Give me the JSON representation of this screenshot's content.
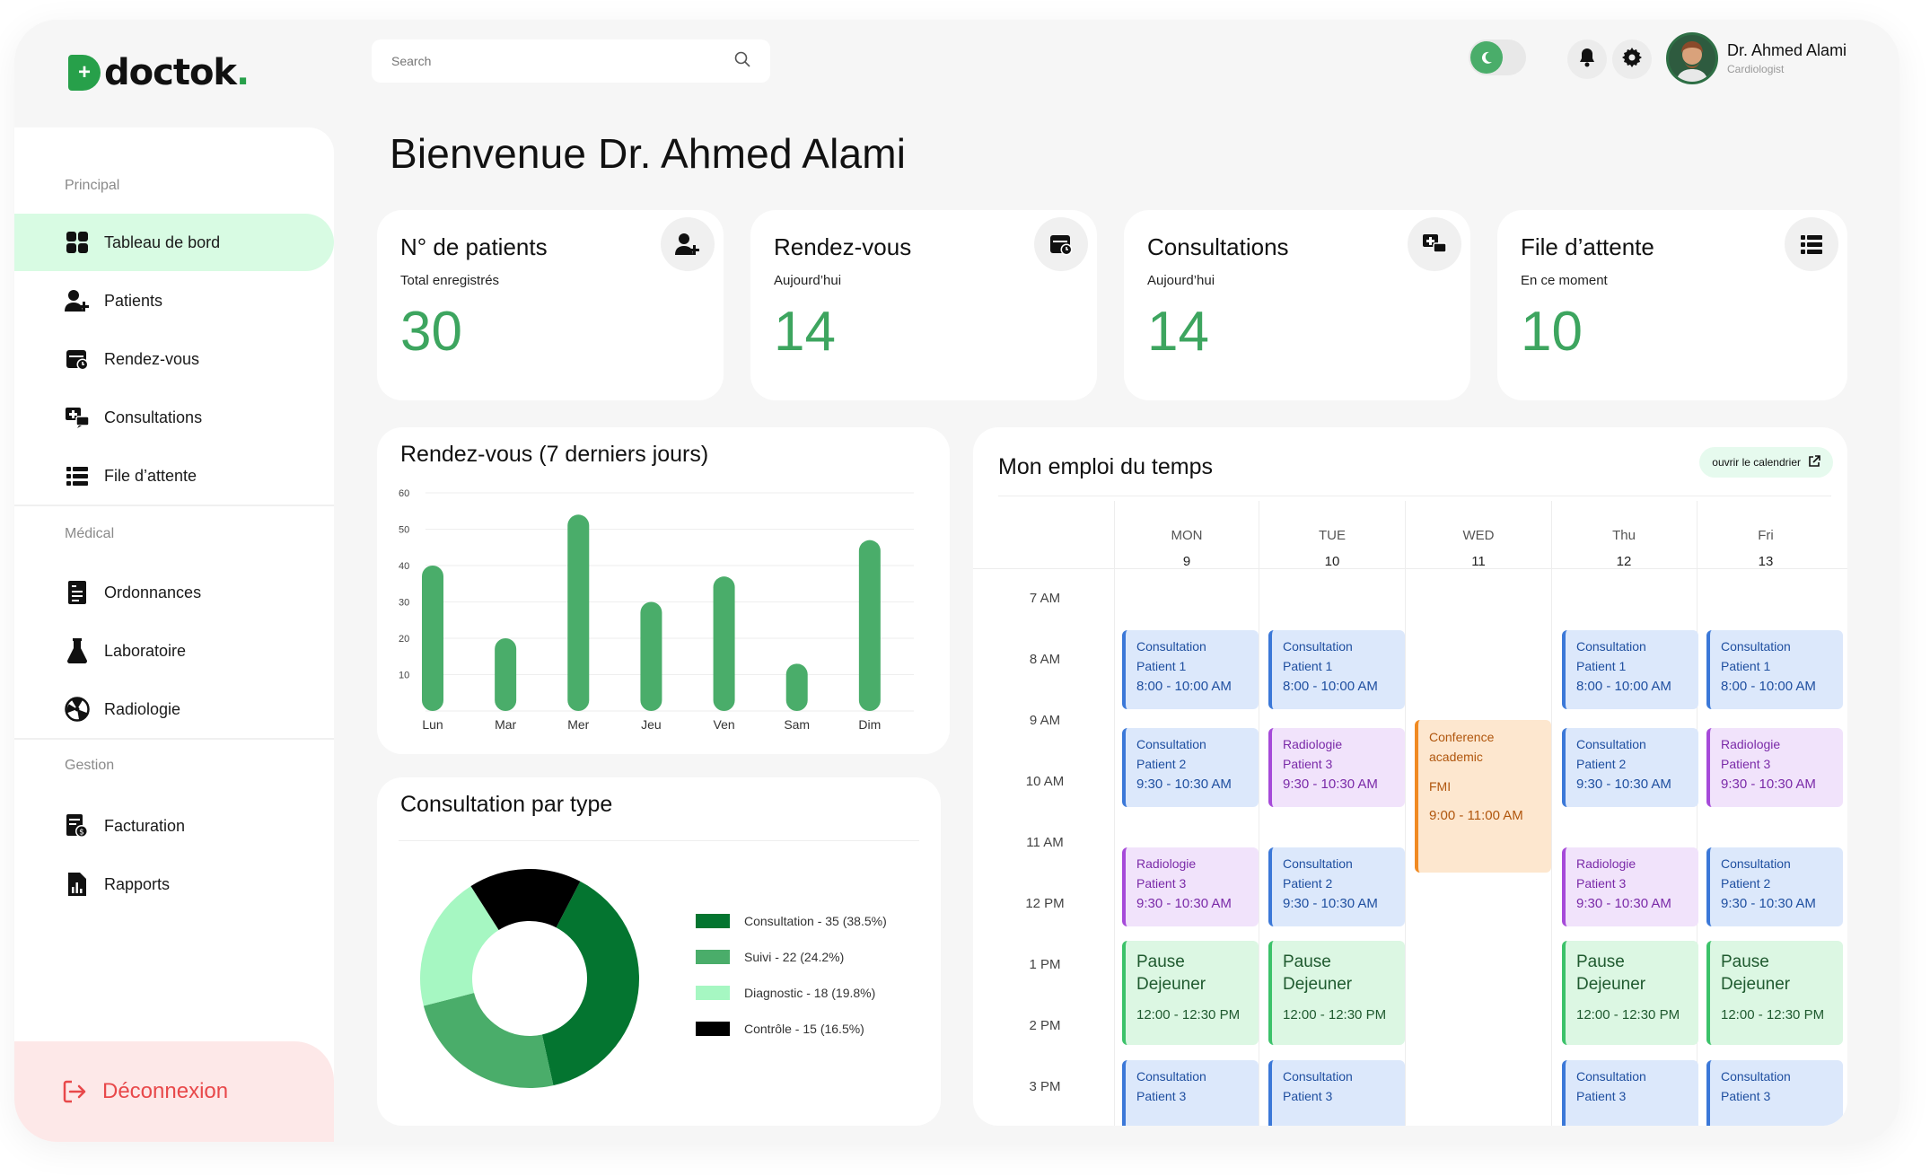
{
  "brand": {
    "name": "doctok",
    "dot": ".",
    "mark": "+"
  },
  "search": {
    "placeholder": "Search"
  },
  "user": {
    "name": "Dr. Ahmed Alami",
    "role": "Cardiologist"
  },
  "welcome": "Bienvenue Dr. Ahmed Alami",
  "sidebar": {
    "sections": [
      "Principal",
      "Médical",
      "Gestion"
    ],
    "items": [
      {
        "label": "Tableau de bord",
        "icon": "dashboard-icon"
      },
      {
        "label": "Patients",
        "icon": "user-plus-icon"
      },
      {
        "label": "Rendez-vous",
        "icon": "calendar-clock-icon"
      },
      {
        "label": "Consultations",
        "icon": "consultation-icon"
      },
      {
        "label": "File d’attente",
        "icon": "list-icon"
      },
      {
        "label": "Ordonnances",
        "icon": "prescription-icon"
      },
      {
        "label": "Laboratoire",
        "icon": "flask-icon"
      },
      {
        "label": "Radiologie",
        "icon": "radiation-icon"
      },
      {
        "label": "Facturation",
        "icon": "invoice-icon"
      },
      {
        "label": "Rapports",
        "icon": "report-icon"
      }
    ],
    "logout": "Déconnexion"
  },
  "stats": [
    {
      "title": "N° de patients",
      "sub": "Total enregistrés",
      "value": "30"
    },
    {
      "title": "Rendez-vous",
      "sub": "Aujourd’hui",
      "value": "14"
    },
    {
      "title": "Consultations",
      "sub": "Aujourd’hui",
      "value": "14"
    },
    {
      "title": "File d’attente",
      "sub": "En ce moment",
      "value": "10"
    }
  ],
  "appointments_chart_title": "Rendez-vous (7 derniers jours)",
  "consult_chart_title": "Consultation par type",
  "chart_data": [
    {
      "type": "bar",
      "title": "Rendez-vous (7 derniers jours)",
      "categories": [
        "Lun",
        "Mar",
        "Mer",
        "Jeu",
        "Ven",
        "Sam",
        "Dim"
      ],
      "values": [
        40,
        20,
        54,
        30,
        37,
        13,
        47
      ],
      "ylim": [
        0,
        60
      ],
      "yticks": [
        10,
        20,
        30,
        40,
        50,
        60
      ],
      "color": "#4aad6a",
      "grid": true
    },
    {
      "type": "pie",
      "title": "Consultation par type",
      "donut": true,
      "slices": [
        {
          "label": "Consultation - 35 (38.5%)",
          "value": 35,
          "color": "#047530"
        },
        {
          "label": "Suivi - 22 (24.2%)",
          "value": 22,
          "color": "#4aad6a"
        },
        {
          "label": "Diagnostic - 18 (19.8%)",
          "value": 18,
          "color": "#a6f7c2"
        },
        {
          "label": "Contrôle - 15 (16.5%)",
          "value": 15,
          "color": "#000000"
        }
      ],
      "legend": "right"
    }
  ],
  "schedule": {
    "title": "Mon emploi du temps",
    "open_calendar": "ouvrir le calendrier",
    "days": [
      {
        "name": "MON",
        "num": "9"
      },
      {
        "name": "TUE",
        "num": "10"
      },
      {
        "name": "WED",
        "num": "11"
      },
      {
        "name": "Thu",
        "num": "12"
      },
      {
        "name": "Fri",
        "num": "13"
      }
    ],
    "times": [
      "7 AM",
      "8 AM",
      "9 AM",
      "10 AM",
      "11 AM",
      "12 PM",
      "1 PM",
      "2 PM",
      "3 PM"
    ],
    "events": [
      {
        "l1": "Consultation",
        "l2": "Patient 1",
        "l3": "8:00 - 10:00 AM"
      },
      {
        "l1": "Consultation",
        "l2": "Patient 2",
        "l3": "9:30 - 10:30 AM"
      },
      {
        "l1": "Radiologie",
        "l2": "Patient 3",
        "l3": "9:30 - 10:30 AM"
      },
      {
        "l1": "Pause",
        "l2": "Dejeuner",
        "l3": "12:00 - 12:30 PM"
      },
      {
        "l1": "Consultation",
        "l2": "Patient 3"
      },
      {
        "l1": "Conference",
        "l2": "academic",
        "l3": "FMI",
        "l4": "9:00 - 11:00 AM"
      }
    ]
  }
}
